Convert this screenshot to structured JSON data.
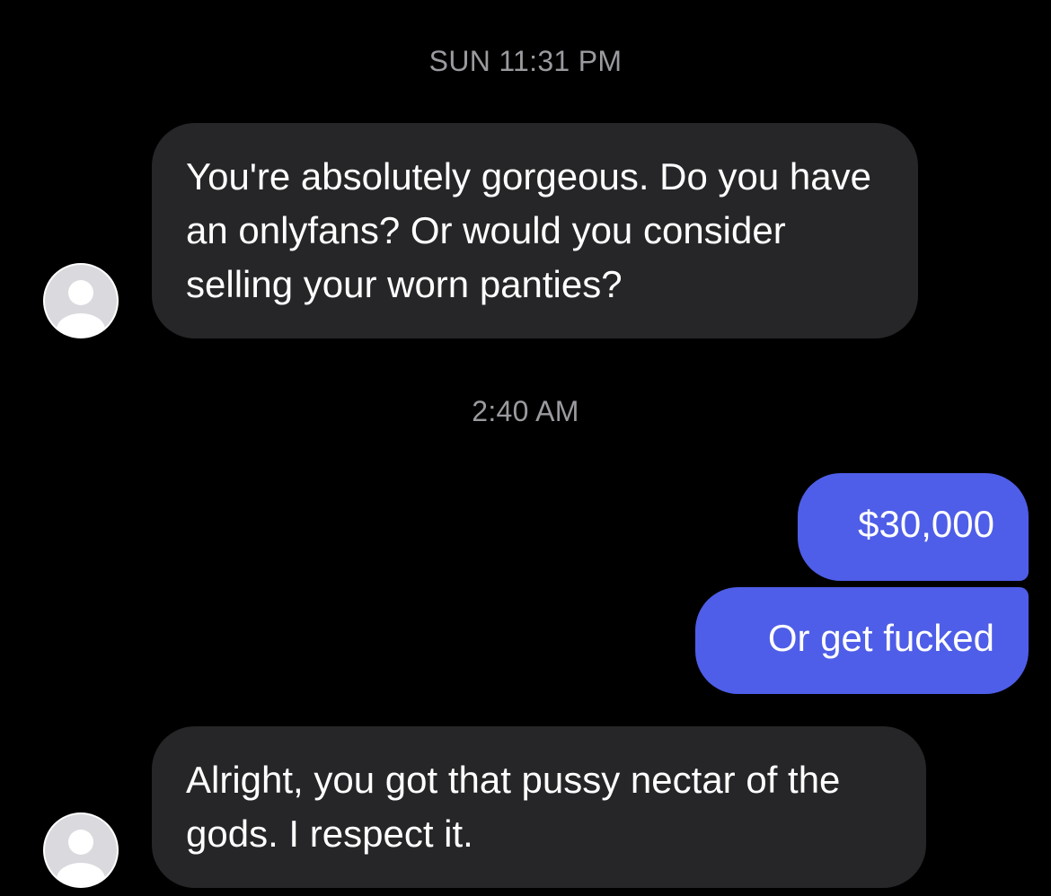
{
  "thread": {
    "messages": [
      {
        "type": "timestamp",
        "text": "SUN 11:31 PM"
      },
      {
        "type": "incoming",
        "text": "You're absolutely gorgeous. Do you have an onlyfans? Or would you consider selling your worn panties?",
        "avatar_icon": "default-profile-icon"
      },
      {
        "type": "timestamp",
        "text": "2:40 AM"
      },
      {
        "type": "outgoing",
        "text": "$30,000"
      },
      {
        "type": "outgoing",
        "text": "Or get fucked"
      },
      {
        "type": "incoming",
        "text": "Alright, you got that pussy nectar of the gods. I respect it.",
        "avatar_icon": "default-profile-icon"
      }
    ]
  },
  "colors": {
    "background": "#000000",
    "incoming_bubble": "#262628",
    "outgoing_bubble": "#4e5ee8",
    "timestamp_text": "#9a9a9f",
    "message_text": "#ffffff"
  }
}
